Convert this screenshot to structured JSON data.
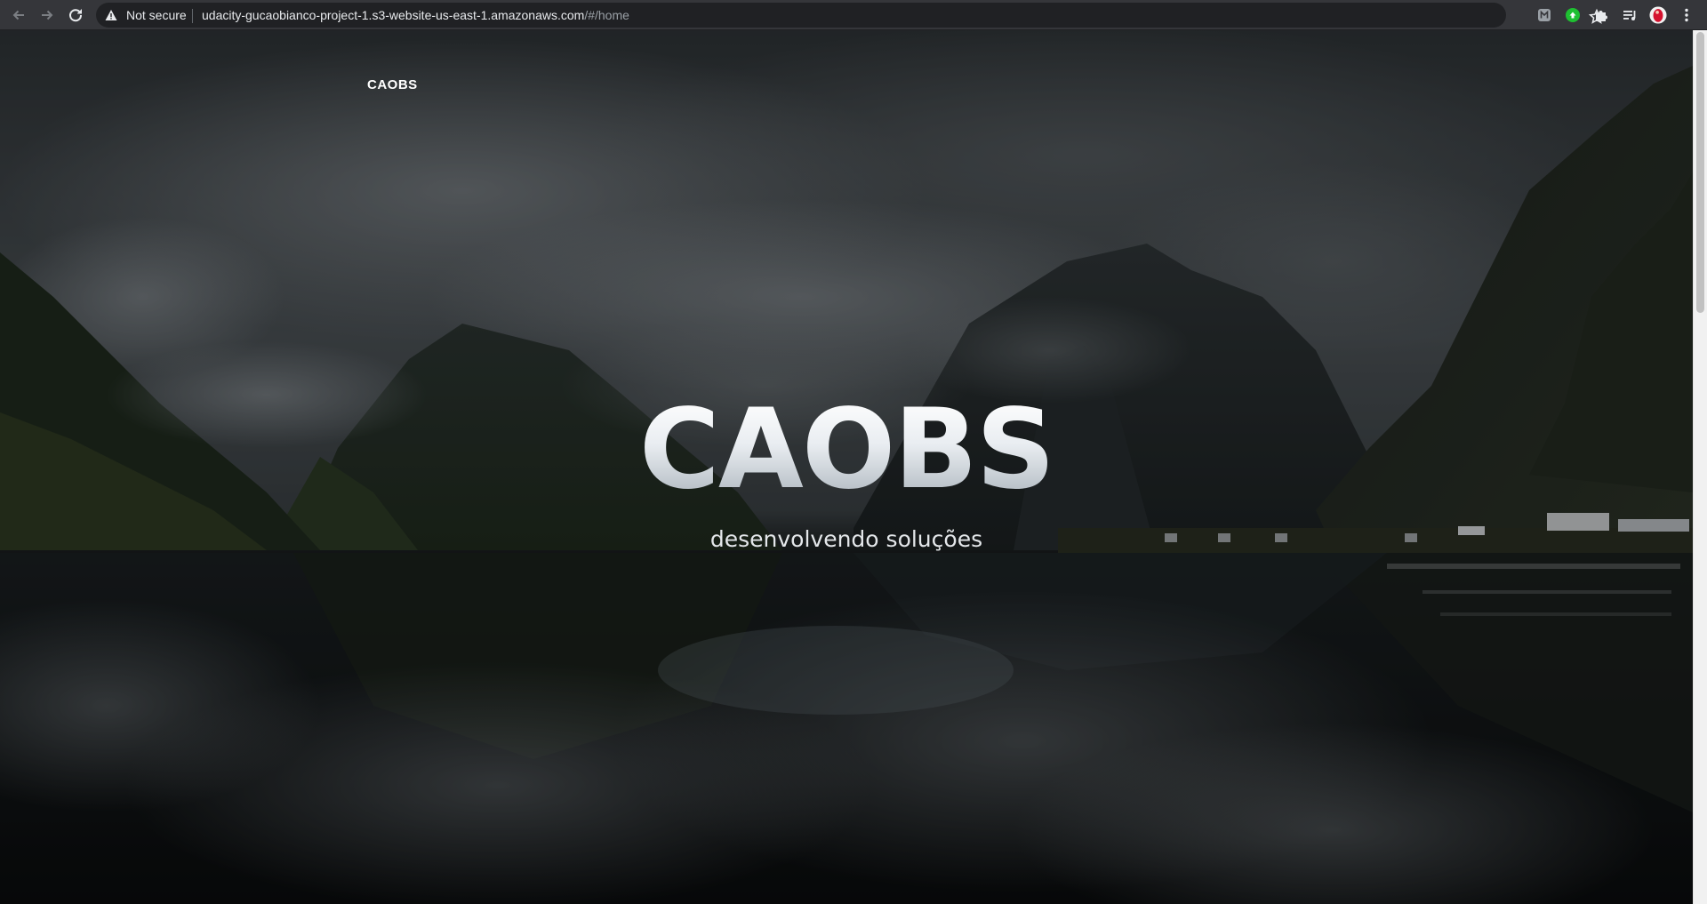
{
  "browser": {
    "security_label": "Not secure",
    "url_host": "udacity-gucaobianco-project-1.s3-website-us-east-1.amazonaws.com",
    "url_path": "/#/home",
    "extensions": [
      "extension-grey-icon",
      "extension-green-icon",
      "puzzle-icon",
      "media-queue-icon"
    ]
  },
  "page": {
    "nav_brand": "CAOBS",
    "hero_title": "CAOBS",
    "hero_subtitle": "desenvolvendo soluções"
  },
  "colors": {
    "chrome_toolbar": "#35363a",
    "omnibox": "#202124",
    "hero_text": "#e6eaee"
  }
}
